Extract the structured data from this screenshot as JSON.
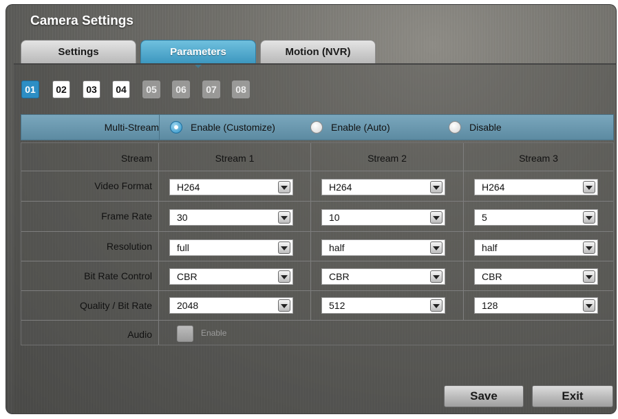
{
  "window": {
    "title": "Camera Settings"
  },
  "tabs": [
    {
      "label": "Settings"
    },
    {
      "label": "Parameters"
    },
    {
      "label": "Motion (NVR)"
    }
  ],
  "active_tab": "Parameters",
  "cameras": [
    {
      "label": "01",
      "state": "selected"
    },
    {
      "label": "02",
      "state": "enabled"
    },
    {
      "label": "03",
      "state": "enabled"
    },
    {
      "label": "04",
      "state": "enabled"
    },
    {
      "label": "05",
      "state": "disabled"
    },
    {
      "label": "06",
      "state": "disabled"
    },
    {
      "label": "07",
      "state": "disabled"
    },
    {
      "label": "08",
      "state": "disabled"
    }
  ],
  "multistream": {
    "label": "Multi-Stream",
    "options": [
      {
        "label": "Enable (Customize)",
        "checked": true
      },
      {
        "label": "Enable (Auto)",
        "checked": false
      },
      {
        "label": "Disable",
        "checked": false
      }
    ]
  },
  "grid": {
    "stream_header_label": "Stream",
    "streams": [
      "Stream 1",
      "Stream 2",
      "Stream 3"
    ],
    "rows": [
      {
        "label": "Video Format",
        "values": [
          "H264",
          "H264",
          "H264"
        ]
      },
      {
        "label": "Frame Rate",
        "values": [
          "30",
          "10",
          "5"
        ]
      },
      {
        "label": "Resolution",
        "values": [
          "full",
          "half",
          "half"
        ]
      },
      {
        "label": "Bit Rate Control",
        "values": [
          "CBR",
          "CBR",
          "CBR"
        ]
      },
      {
        "label": "Quality / Bit Rate",
        "values": [
          "2048",
          "512",
          "128"
        ]
      }
    ],
    "audio": {
      "label": "Audio",
      "checkbox_label": "Enable",
      "checked": false
    }
  },
  "buttons": {
    "save": "Save",
    "exit": "Exit"
  },
  "colors": {
    "accent": "#3d97bf",
    "selected_camera": "#2d8ec4",
    "multistream_bg": "#6b98ae"
  }
}
